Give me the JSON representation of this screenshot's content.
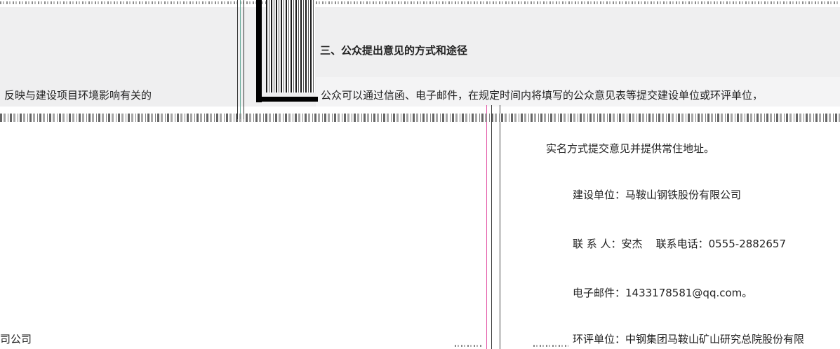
{
  "section_heading": "三、公众提出意见的方式和途径",
  "left_fragment": "反映与建设项目环境影响有关的",
  "intro_line": "公众可以通过信函、电子邮件，在规定时间内将填写的公众意见表等提交建设单位或环评单位，",
  "realname_line": "实名方式提交意见并提供常住地址。",
  "builder_line": "建设单位：马鞍山钢铁股份有限公司",
  "contact_line": "联 系 人：安杰    联系电话：0555-2882657",
  "email_line": "电子邮件：1433178581@qq.com。",
  "evaluator_line": "环评单位：中钢集团马鞍山矿山研究总院股份有限",
  "bottom_left_fragment": "司公司"
}
